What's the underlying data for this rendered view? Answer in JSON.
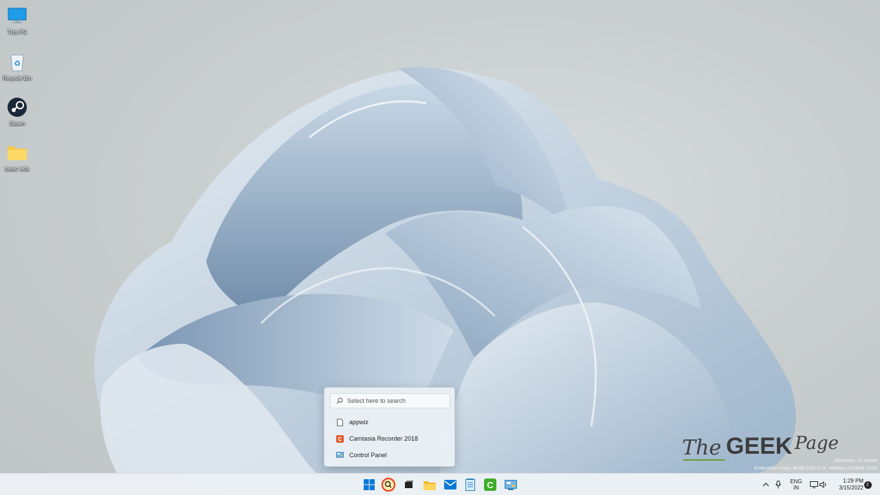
{
  "desktop_icons": [
    {
      "label": "This PC",
      "icon": "monitor-icon"
    },
    {
      "label": "Recycle Bin",
      "icon": "recycle-bin-icon"
    },
    {
      "label": "Steam",
      "icon": "steam-icon"
    },
    {
      "label": "basic vids",
      "icon": "folder-icon"
    }
  ],
  "search_popup": {
    "placeholder": "Select here to search",
    "results": [
      {
        "label": "appwiz",
        "icon": "file-icon"
      },
      {
        "label": "Camtasia Recorder 2018",
        "icon": "camtasia-icon"
      },
      {
        "label": "Control Panel",
        "icon": "control-panel-icon"
      }
    ]
  },
  "logo": {
    "the": "The",
    "geek": "GEEK",
    "page": "Page"
  },
  "watermark": {
    "line1": "Windows 11 Home",
    "line2": "Evaluation copy. Build 22572.ni_release.220304-1536"
  },
  "taskbar": {
    "apps": [
      "start-icon",
      "search-icon",
      "task-view-icon",
      "file-explorer-icon",
      "mail-icon",
      "notepad-icon",
      "camtasia-icon",
      "control-panel-icon"
    ],
    "tray": {
      "lang_line1": "ENG",
      "lang_line2": "IN",
      "time": "1:29 PM",
      "date": "3/15/2022",
      "notification_count": "2"
    }
  },
  "colors": {
    "accent": "#0067c0",
    "click_highlight": "#e53935",
    "camtasia": "#e0572a"
  }
}
